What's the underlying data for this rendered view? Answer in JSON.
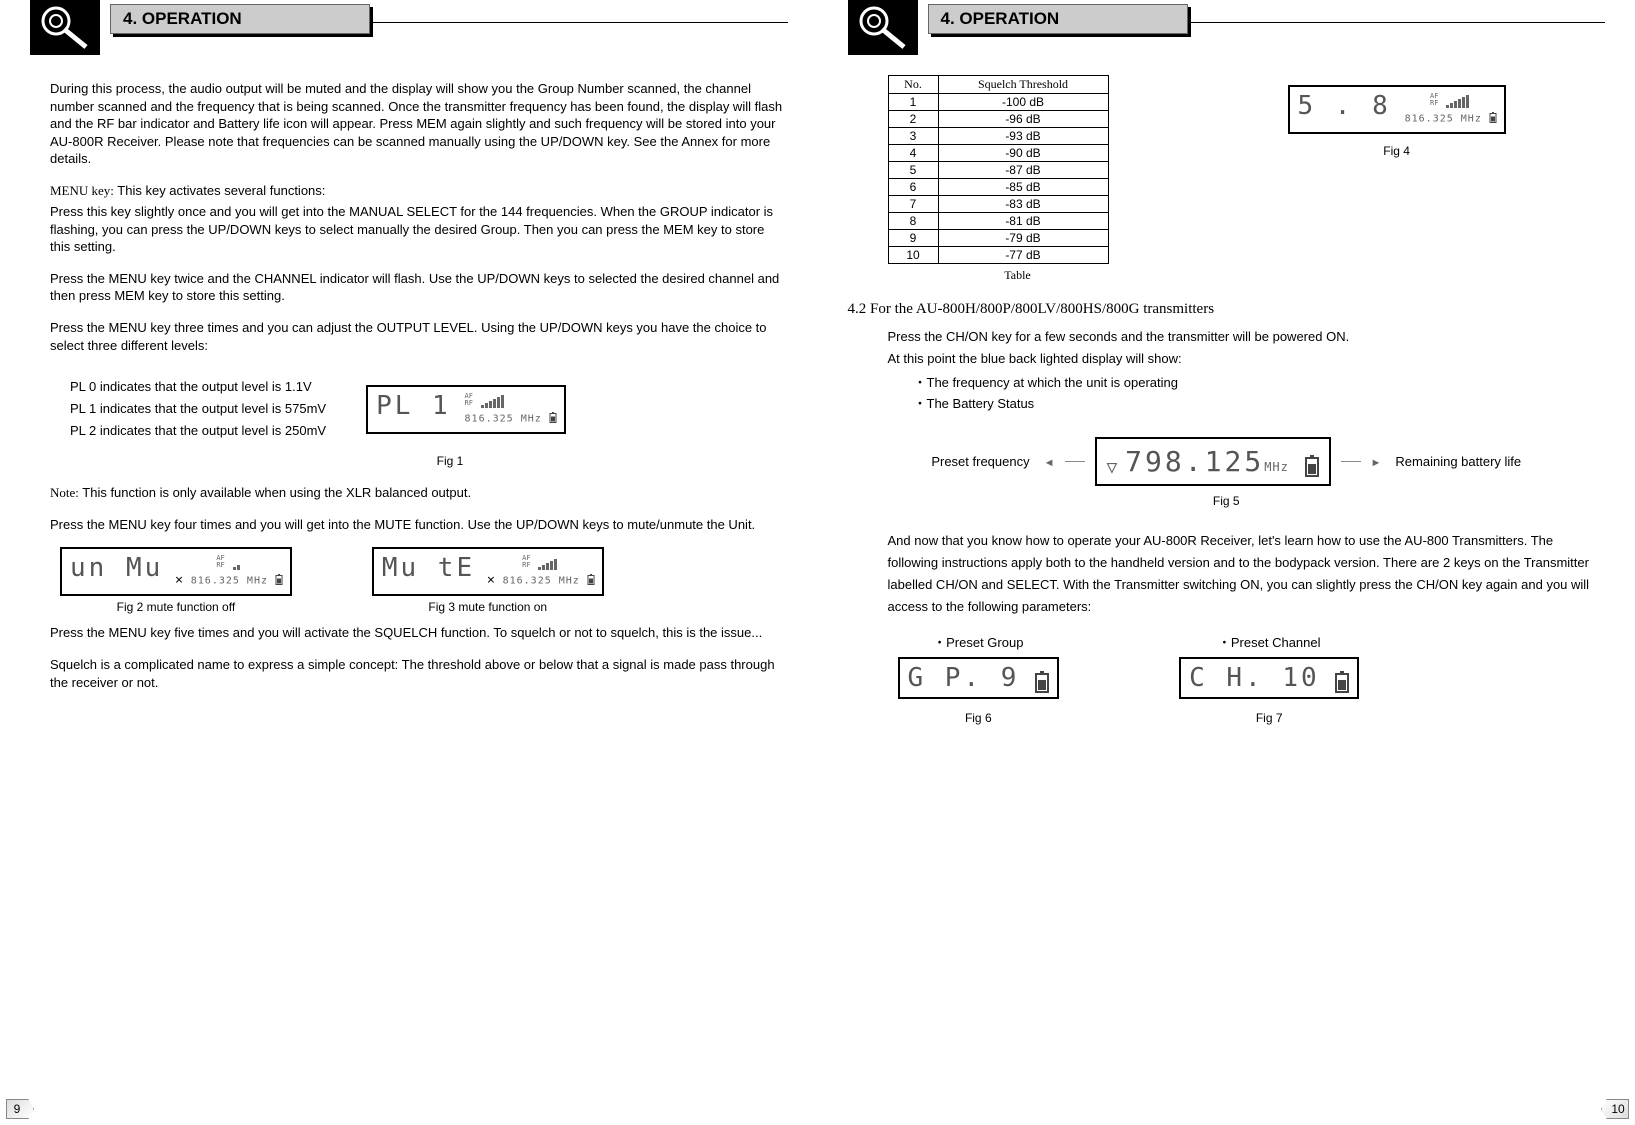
{
  "section_header": "4. OPERATION",
  "left": {
    "intro": "During this process, the audio output will be muted and the display will show you the Group Number scanned, the channel number scanned and the frequency that is being scanned. Once the transmitter frequency has been found, the display will flash and the RF bar indicator and Battery life icon will appear. Press MEM again slightly and such frequency will be stored into your AU-800R Receiver. Please note that frequencies can be scanned manually using the UP/DOWN key. See the Annex for more details.",
    "menu_key_label": "MENU key:",
    "menu_key_intro": " This key activates several functions:",
    "menu_p1": "Press this key slightly once and you will get into the MANUAL SELECT for the 144 frequencies. When the GROUP indicator is flashing, you can press the UP/DOWN keys to select manually the desired Group. Then you can press the MEM key to store this setting.",
    "menu_p2": "Press the MENU key twice and the CHANNEL indicator will flash. Use the UP/DOWN keys to selected the desired channel and then press MEM key to store this setting.",
    "menu_p3": "Press the MENU key three times and you can adjust the OUTPUT LEVEL. Using the UP/DOWN keys you have the choice to select three different levels:",
    "pl0": "PL 0 indicates that the output level is 1.1V",
    "pl1": "PL 1 indicates that the output level is 575mV",
    "pl2": "PL 2 indicates that the output level is 250mV",
    "fig1_lcd_main": "PL   1",
    "fig1_af": "AF",
    "fig1_rf": "RF",
    "fig1_freq": "816.325 MHz",
    "fig1_caption": "Fig 1",
    "note_label": "Note:",
    "note_text": " This function is only available when using the XLR balanced output.",
    "menu_p4": "Press the MENU key four times and you will get into the MUTE function. Use the UP/DOWN keys to mute/unmute the Unit.",
    "fig2_lcd": "un Mu",
    "fig2_caption": "Fig 2  mute function off",
    "fig3_lcd": "Mu  tE",
    "fig3_caption": "Fig 3 mute function on",
    "fig23_af": "AF",
    "fig23_rf": "RF",
    "fig23_freq": "816.325 MHz",
    "menu_p5": "Press the MENU key five times and you will activate the SQUELCH function. To squelch or not to squelch, this is the issue...",
    "menu_p6": "Squelch is a complicated name to express a simple concept: The threshold above or below that a signal is made pass through the receiver or not.",
    "page_number": "9"
  },
  "right": {
    "table_header_no": "No.",
    "table_header_sq": "Squelch Threshold",
    "table_rows": [
      {
        "n": "1",
        "v": "-100 dB"
      },
      {
        "n": "2",
        "v": "-96 dB"
      },
      {
        "n": "3",
        "v": "-93 dB"
      },
      {
        "n": "4",
        "v": "-90 dB"
      },
      {
        "n": "5",
        "v": "-87 dB"
      },
      {
        "n": "6",
        "v": "-85 dB"
      },
      {
        "n": "7",
        "v": "-83 dB"
      },
      {
        "n": "8",
        "v": "-81 dB"
      },
      {
        "n": "9",
        "v": "-79 dB"
      },
      {
        "n": "10",
        "v": "-77 dB"
      }
    ],
    "table_caption": "Table",
    "fig4_lcd_main": "5 . 8",
    "fig4_af": "AF",
    "fig4_rf": "RF",
    "fig4_freq": "816.325 MHz",
    "fig4_caption": "Fig 4",
    "subsection": "4.2 For the AU-800H/800P/800LV/800HS/800G transmitters",
    "p1": "Press the CH/ON key for a few seconds and the transmitter will be powered ON.",
    "p2": "At this point the blue back lighted display will show:",
    "b1": "The frequency at which the unit is operating",
    "b2": "The Battery Status",
    "fig5_left_label": "Preset frequency",
    "fig5_lcd": "798.125",
    "fig5_unit": "MHz",
    "fig5_right_label": "Remaining battery life",
    "fig5_caption": "Fig 5",
    "p3": "And now that you know how to operate your AU-800R Receiver, let's learn how to use the AU-800 Transmitters. The following instructions apply both to the handheld version and to the bodypack version. There are 2 keys on the Transmitter labelled CH/ON and SELECT. With the Transmitter switching ON, you can slightly press the CH/ON key again and you will access to the following parameters:",
    "fig6_label": "Preset Group",
    "fig6_lcd": "G P.  9",
    "fig6_caption": "Fig 6",
    "fig7_label": "Preset Channel",
    "fig7_lcd": "C H. 10",
    "fig7_caption": "Fig 7",
    "page_number": "10"
  },
  "chart_data": {
    "type": "table",
    "title": "Squelch Threshold",
    "columns": [
      "No.",
      "Squelch Threshold"
    ],
    "rows": [
      [
        1,
        "-100 dB"
      ],
      [
        2,
        "-96 dB"
      ],
      [
        3,
        "-93 dB"
      ],
      [
        4,
        "-90 dB"
      ],
      [
        5,
        "-87 dB"
      ],
      [
        6,
        "-85 dB"
      ],
      [
        7,
        "-83 dB"
      ],
      [
        8,
        "-81 dB"
      ],
      [
        9,
        "-79 dB"
      ],
      [
        10,
        "-77 dB"
      ]
    ]
  }
}
